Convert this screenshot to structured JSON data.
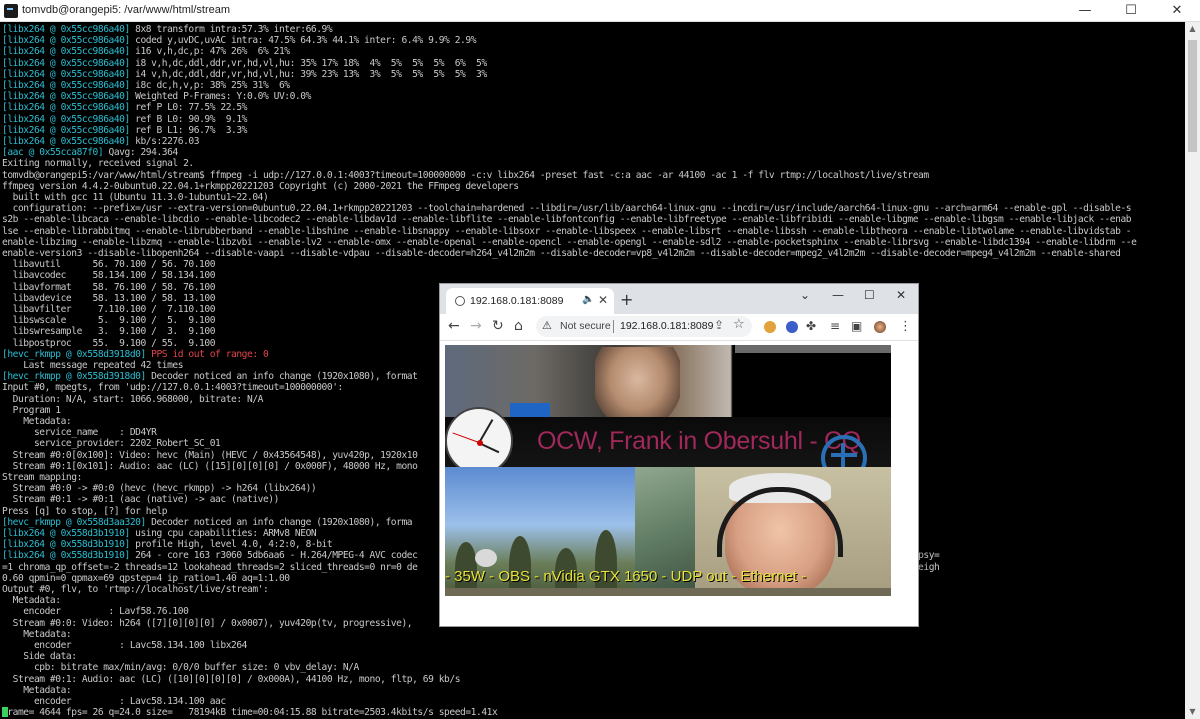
{
  "terminal": {
    "title": "tomvdb@orangepi5: /var/www/html/stream",
    "controls": {
      "minimize": "—",
      "maximize": "☐",
      "close": "✕"
    },
    "lines": [
      [
        {
          "t": "[libx264 @ 0x55cc986a40]",
          "c": "tag"
        },
        {
          "t": " 8x8 transform intra:57.3% inter:66.9%"
        }
      ],
      [
        {
          "t": "[libx264 @ 0x55cc986a40]",
          "c": "tag"
        },
        {
          "t": " coded y,uvDC,uvAC intra: 47.5% 64.3% 44.1% inter: 6.4% 9.9% 2.9%"
        }
      ],
      [
        {
          "t": "[libx264 @ 0x55cc986a40]",
          "c": "tag"
        },
        {
          "t": " i16 v,h,dc,p: 47% 26%  6% 21%"
        }
      ],
      [
        {
          "t": "[libx264 @ 0x55cc986a40]",
          "c": "tag"
        },
        {
          "t": " i8 v,h,dc,ddl,ddr,vr,hd,vl,hu: 35% 17% 18%  4%  5%  5%  5%  6%  5%"
        }
      ],
      [
        {
          "t": "[libx264 @ 0x55cc986a40]",
          "c": "tag"
        },
        {
          "t": " i4 v,h,dc,ddl,ddr,vr,hd,vl,hu: 39% 23% 13%  3%  5%  5%  5%  5%  3%"
        }
      ],
      [
        {
          "t": "[libx264 @ 0x55cc986a40]",
          "c": "tag"
        },
        {
          "t": " i8c dc,h,v,p: 38% 25% 31%  6%"
        }
      ],
      [
        {
          "t": "[libx264 @ 0x55cc986a40]",
          "c": "tag"
        },
        {
          "t": " Weighted P-Frames: Y:0.0% UV:0.0%"
        }
      ],
      [
        {
          "t": "[libx264 @ 0x55cc986a40]",
          "c": "tag"
        },
        {
          "t": " ref P L0: 77.5% 22.5%"
        }
      ],
      [
        {
          "t": "[libx264 @ 0x55cc986a40]",
          "c": "tag"
        },
        {
          "t": " ref B L0: 90.9%  9.1%"
        }
      ],
      [
        {
          "t": "[libx264 @ 0x55cc986a40]",
          "c": "tag"
        },
        {
          "t": " ref B L1: 96.7%  3.3%"
        }
      ],
      [
        {
          "t": "[libx264 @ 0x55cc986a40]",
          "c": "tag"
        },
        {
          "t": " kb/s:2276.03"
        }
      ],
      [
        {
          "t": "[aac @ 0x55cca87f0]",
          "c": "tag"
        },
        {
          "t": " Qavg: 294.364"
        }
      ],
      [
        {
          "t": "Exiting normally, received signal 2."
        }
      ],
      [
        {
          "t": "tomvdb@orangepi5:/var/www/html/stream$ ffmpeg -i udp://127.0.0.1:4003?timeout=100000000 -c:v libx264 -preset fast -c:a aac -ar 44100 -ac 1 -f flv rtmp://localhost/live/stream"
        }
      ],
      [
        {
          "t": "ffmpeg version 4.4.2-0ubuntu0.22.04.1+rkmpp20221203 Copyright (c) 2000-2021 the FFmpeg developers"
        }
      ],
      [
        {
          "t": "  built with gcc 11 (Ubuntu 11.3.0-1ubuntu1~22.04)"
        }
      ],
      [
        {
          "t": "  configuration: --prefix=/usr --extra-version=0ubuntu0.22.04.1+rkmpp20221203 --toolchain=hardened --libdir=/usr/lib/aarch64-linux-gnu --incdir=/usr/include/aarch64-linux-gnu --arch=arm64 --enable-gpl --disable-s"
        }
      ],
      [
        {
          "t": "s2b --enable-libcaca --enable-libcdio --enable-libcodec2 --enable-libdav1d --enable-libflite --enable-libfontconfig --enable-libfreetype --enable-libfribidi --enable-libgme --enable-libgsm --enable-libjack --enab"
        }
      ],
      [
        {
          "t": "lse --enable-librabbitmq --enable-librubberband --enable-libshine --enable-libsnappy --enable-libsoxr --enable-libspeex --enable-libsrt --enable-libssh --enable-libtheora --enable-libtwolame --enable-libvidstab -"
        }
      ],
      [
        {
          "t": "enable-libzimg --enable-libzmq --enable-libzvbi --enable-lv2 --enable-omx --enable-openal --enable-opencl --enable-opengl --enable-sdl2 --enable-pocketsphinx --enable-librsvg --enable-libdc1394 --enable-libdrm --e"
        }
      ],
      [
        {
          "t": "enable-version3 --disable-libopenh264 --disable-vaapi --disable-vdpau --disable-decoder=h264_v4l2m2m --disable-decoder=vp8_v4l2m2m --disable-decoder=mpeg2_v4l2m2m --disable-decoder=mpeg4_v4l2m2m --enable-shared"
        }
      ],
      [
        {
          "t": "  libavutil      56. 70.100 / 56. 70.100"
        }
      ],
      [
        {
          "t": "  libavcodec     58.134.100 / 58.134.100"
        }
      ],
      [
        {
          "t": "  libavformat    58. 76.100 / 58. 76.100"
        }
      ],
      [
        {
          "t": "  libavdevice    58. 13.100 / 58. 13.100"
        }
      ],
      [
        {
          "t": "  libavfilter     7.110.100 /  7.110.100"
        }
      ],
      [
        {
          "t": "  libswscale      5.  9.100 /  5.  9.100"
        }
      ],
      [
        {
          "t": "  libswresample   3.  9.100 /  3.  9.100"
        }
      ],
      [
        {
          "t": "  libpostproc    55.  9.100 / 55.  9.100"
        }
      ],
      [
        {
          "t": "[hevc_rkmpp @ 0x558d3918d0]",
          "c": "tag"
        },
        {
          "t": " PPS id out of range: 0",
          "c": "err"
        }
      ],
      [
        {
          "t": "    Last message repeated 42 times"
        }
      ],
      [
        {
          "t": "[hevc_rkmpp @ 0x558d3918d0]",
          "c": "tag"
        },
        {
          "t": " Decoder noticed an info change (1920x1080), format"
        }
      ],
      [
        {
          "t": "Input #0, mpegts, from 'udp://127.0.0.1:4003?timeout=100000000':"
        }
      ],
      [
        {
          "t": "  Duration: N/A, start: 1066.968000, bitrate: N/A"
        }
      ],
      [
        {
          "t": "  Program 1"
        }
      ],
      [
        {
          "t": "    Metadata:"
        }
      ],
      [
        {
          "t": "      service_name    : DD4YR"
        }
      ],
      [
        {
          "t": "      service_provider: 2202_Robert_SC_01"
        }
      ],
      [
        {
          "t": "  Stream #0:0[0x100]: Video: hevc (Main) (HEVC / 0x43564548), yuv420p, 1920x10"
        }
      ],
      [
        {
          "t": "  Stream #0:1[0x101]: Audio: aac (LC) ([15][0][0][0] / 0x000F), 48000 Hz, mono"
        }
      ],
      [
        {
          "t": "Stream mapping:"
        }
      ],
      [
        {
          "t": "  Stream #0:0 -> #0:0 (hevc (hevc_rkmpp) -> h264 (libx264))"
        }
      ],
      [
        {
          "t": "  Stream #0:1 -> #0:1 (aac (native) -> aac (native))"
        }
      ],
      [
        {
          "t": "Press [q] to stop, [?] for help"
        }
      ],
      [
        {
          "t": "[hevc_rkmpp @ 0x558d3aa320]",
          "c": "tag"
        },
        {
          "t": " Decoder noticed an info change (1920x1080), forma"
        }
      ],
      [
        {
          "t": "[libx264 @ 0x558d3b1910]",
          "c": "tag"
        },
        {
          "t": " using cpu capabilities: ARMv8 NEON"
        }
      ],
      [
        {
          "t": "[libx264 @ 0x558d3b1910]",
          "c": "tag"
        },
        {
          "t": " profile High, level 4.0, 4:2:0, 8-bit"
        }
      ],
      [
        {
          "t": "[libx264 @ 0x558d3b1910]",
          "c": "tag"
        },
        {
          "t": " 264 - core 163 r3060 5db6aa6 - H.264/MPEG-4 AVC codec                                                  lock=1:0:0 analyse=0x3:0x113 me=hex subme=6 psy="
        }
      ],
      [
        {
          "t": "=1 chroma_qp_offset=-2 threads=12 lookahead_threads=2 sliced_threads=0 nr=0 de                                                   =1 b_bias=0 direct=1 weightb=1 open_gop=0 weigh"
        }
      ],
      [
        {
          "t": "0.60 qpmin=0 qpmax=69 qpstep=4 ip_ratio=1.40 aq=1:1.00"
        }
      ],
      [
        {
          "t": "Output #0, flv, to 'rtmp://localhost/live/stream':"
        }
      ],
      [
        {
          "t": "  Metadata:"
        }
      ],
      [
        {
          "t": "    encoder         : Lavf58.76.100"
        }
      ],
      [
        {
          "t": "  Stream #0:0: Video: h264 ([7][0][0][0] / 0x0007), yuv420p(tv, progressive),"
        }
      ],
      [
        {
          "t": "    Metadata:"
        }
      ],
      [
        {
          "t": "      encoder         : Lavc58.134.100 libx264"
        }
      ],
      [
        {
          "t": "    Side data:"
        }
      ],
      [
        {
          "t": "      cpb: bitrate max/min/avg: 0/0/0 buffer size: 0 vbv_delay: N/A"
        }
      ],
      [
        {
          "t": "  Stream #0:1: Audio: aac (LC) ([10][0][0][0] / 0x000A), 44100 Hz, mono, fltp, 69 kb/s"
        }
      ],
      [
        {
          "t": "    Metadata:"
        }
      ],
      [
        {
          "t": "      encoder         : Lavc58.134.100 aac"
        }
      ],
      [
        {
          "t": "frame= 4644 fps= 26 q=24.0 size=   78194kB time=00:04:15.88 bitrate=2503.4kbits/s speed=1.41x"
        }
      ]
    ]
  },
  "browser": {
    "tab_title": "192.168.0.181:8089",
    "tab_audio_icon": "🔈",
    "tab_close": "✕",
    "new_tab": "+",
    "window_controls": {
      "collapse": "⌄",
      "minimize": "—",
      "maximize": "☐",
      "close": "✕"
    },
    "nav": {
      "back": "←",
      "forward": "→",
      "reload": "↻",
      "home": "⌂"
    },
    "security_label": "Not secure",
    "url": "192.168.0.181:8089",
    "more_menu": "⋮",
    "extensions": [
      "cookie-extension",
      "vpn-extension",
      "puzzle-extensions",
      "media-queue",
      "side-panel",
      "profile-avatar"
    ],
    "video": {
      "banner_text": "OCW, Frank in Obersuhl - CQ",
      "ticker_text": "- 35W  - OBS - nVidia GTX 1650 - UDP out - Ethernet  -"
    }
  },
  "colors": {
    "tag": "#2bbfd1",
    "error": "#e0454f",
    "text": "#c9c9c9",
    "prompt_cursor": "#3bd15a"
  }
}
